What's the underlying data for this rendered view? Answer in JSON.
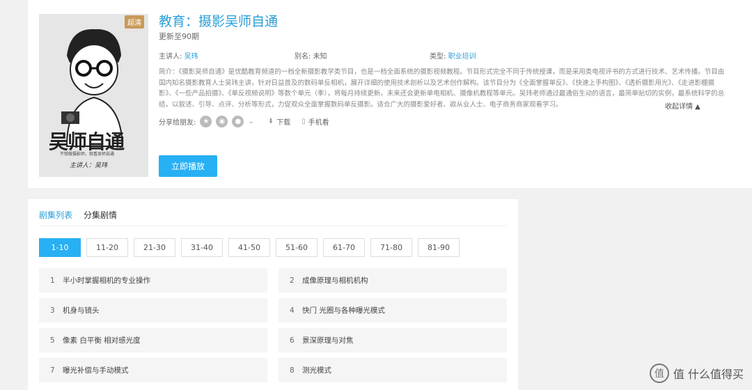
{
  "show": {
    "badge": "超清",
    "title": "教育：摄影吴师自通",
    "update": "更新至90期",
    "host_label": "主讲人:",
    "host": "吴玮",
    "alias_label": "别名:",
    "alias": "未知",
    "type_label": "类型:",
    "type": "职业培训",
    "description": "简介：《摄影吴师自通》是优酷教育频道的一档全新摄影教学类节目，也是一档全面系统的摄影视频教程。节目形式完全不同于传统授课，而是采用类电视评书的方式进行技术、艺术传播。节目由国内知名摄影教育人士吴玮主讲，针对日益普及的数码单反相机，展开详细的使用技术剖析以及艺术创作解构。该节目分为《全面掌握单反》、《快速上手构图》、《透析摄影用光》、《走进影棚摄影》、《一些产品拍摄》、《单反视频说明》等数个单元（季），将每月持续更新。未来还会更新单电相机、摄像机教程等单元。吴玮老师通过最通俗生动的语言，最简单贴切的实例，最系统科学的总结，以叙述、引导、点评、分析等形式，力促观众全面掌握数码单反摄影。适合广大的摄影爱好者、欲从业人士、电子商务商家观看学习。",
    "collapse_label": "收起详情 ▲",
    "share_label": "分享给朋友:",
    "download_label": "下载",
    "mobile_label": "手机看",
    "play_label": "立即播放",
    "poster_text": "吴师自通",
    "poster_sub": "不想做摄影师，就看吴师自通",
    "poster_host": "主讲人：吴玮"
  },
  "tabs": [
    {
      "label": "剧集列表"
    },
    {
      "label": "分集剧情"
    }
  ],
  "pages": [
    "1-10",
    "11-20",
    "21-30",
    "31-40",
    "41-50",
    "51-60",
    "61-70",
    "71-80",
    "81-90"
  ],
  "episodes": [
    {
      "num": "1",
      "title": "半小时掌握相机的专业操作"
    },
    {
      "num": "2",
      "title": "成像原理与相机机构"
    },
    {
      "num": "3",
      "title": "机身与镜头"
    },
    {
      "num": "4",
      "title": "快门 光圈与各种曝光模式"
    },
    {
      "num": "5",
      "title": "像素 白平衡 相对感光度"
    },
    {
      "num": "6",
      "title": "景深原理与对焦"
    },
    {
      "num": "7",
      "title": "曝光补偿与手动模式"
    },
    {
      "num": "8",
      "title": "测光模式"
    }
  ],
  "watermark": "值 什么值得买"
}
